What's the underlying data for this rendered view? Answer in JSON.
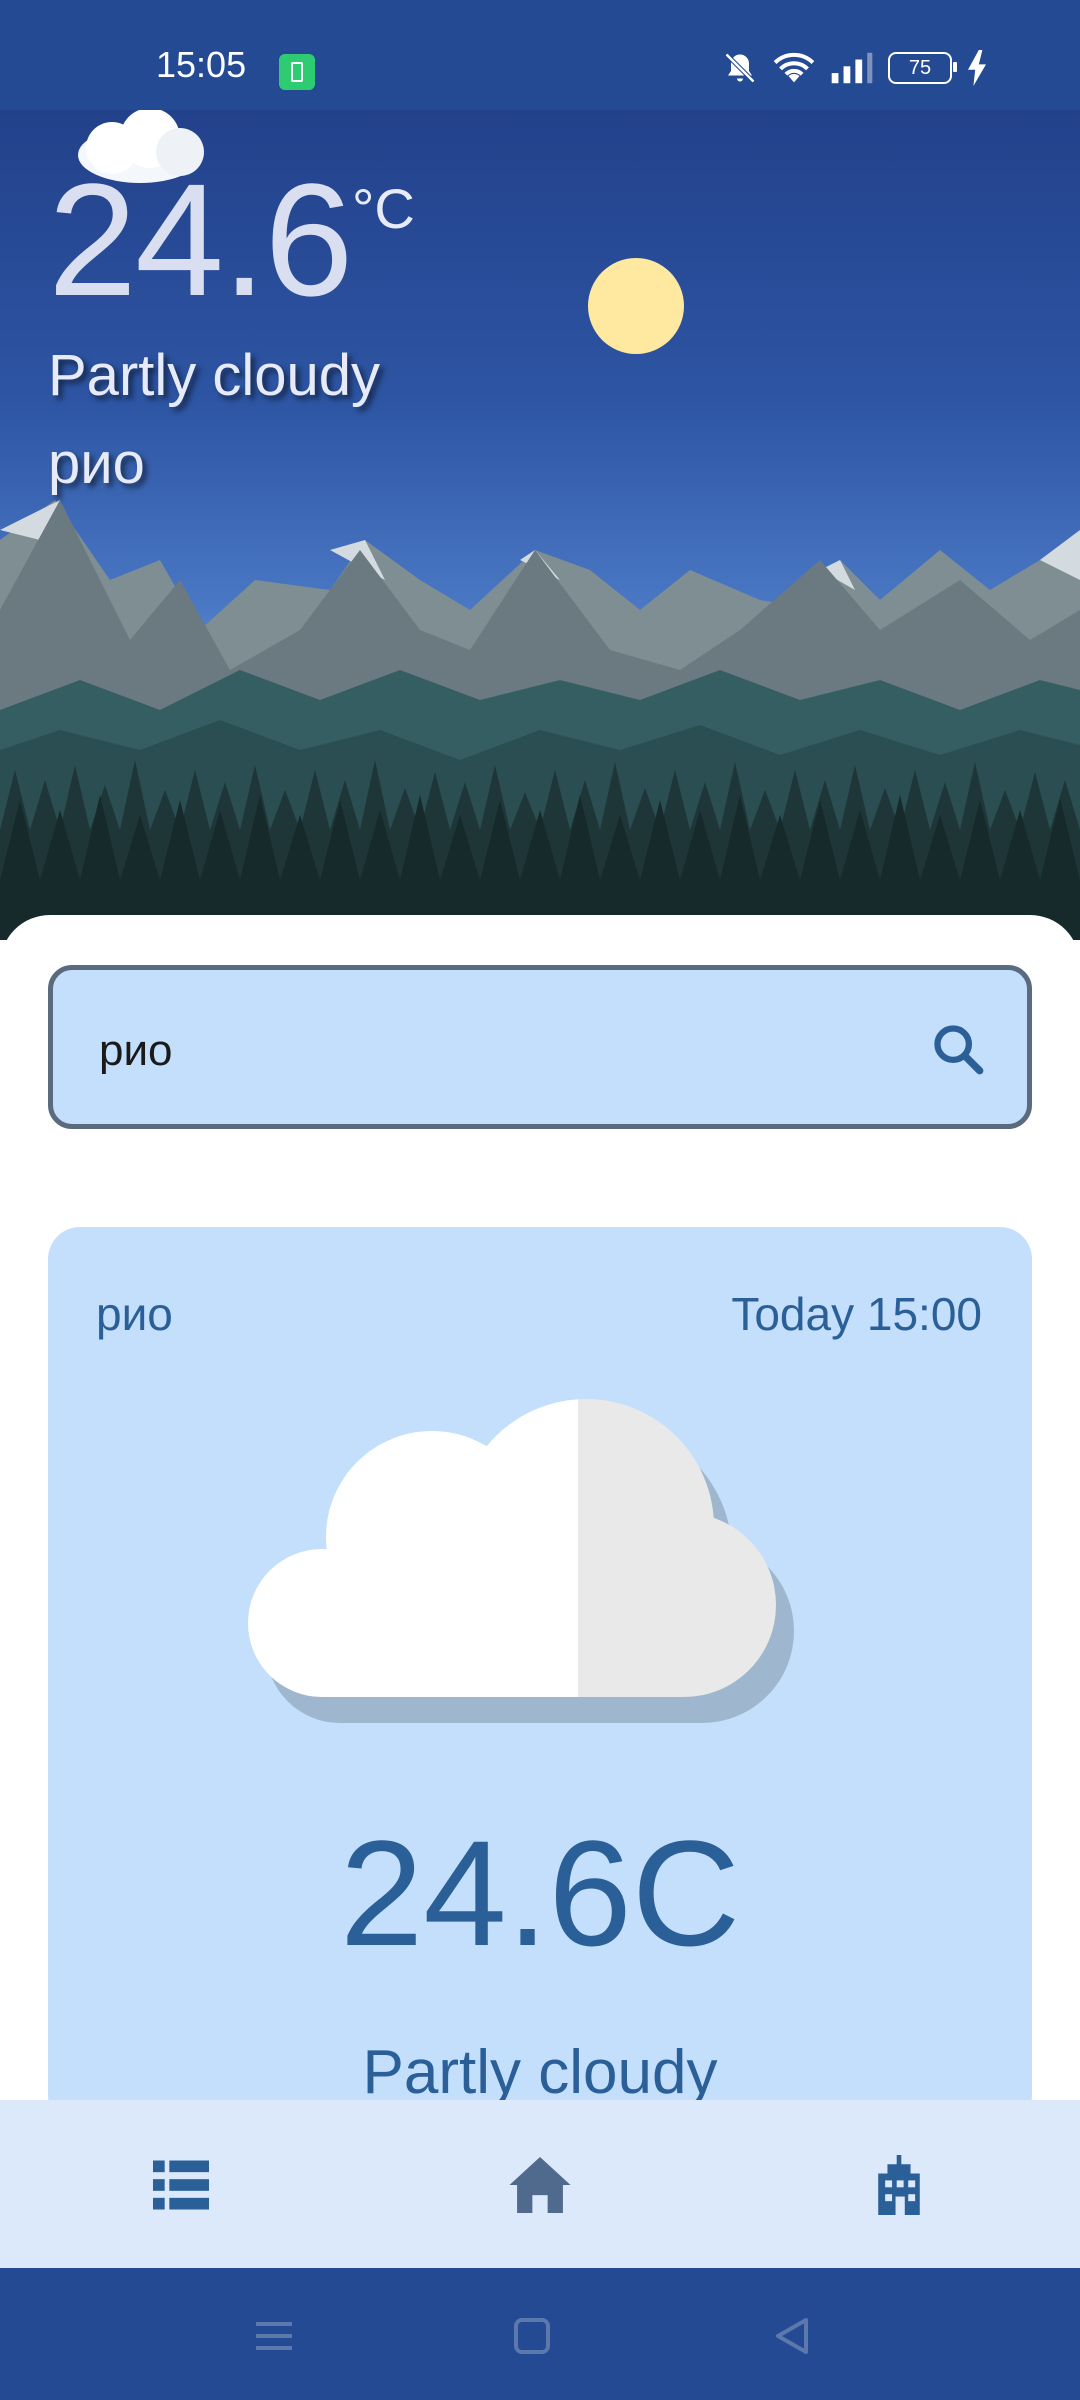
{
  "status_bar": {
    "time": "15:05",
    "battery_level": "75",
    "icons": [
      "battery-saver-icon",
      "mute-icon",
      "wifi-icon",
      "signal-icon",
      "battery-icon",
      "charging-icon"
    ]
  },
  "hero": {
    "temperature": "24.6",
    "unit": "°C",
    "condition": "Partly cloudy",
    "city": "рио"
  },
  "search": {
    "value": "рио",
    "placeholder": ""
  },
  "card": {
    "city": "рио",
    "time": "Today 15:00",
    "temperature": "24.6C",
    "condition": "Partly cloudy",
    "icon": "partly-cloudy-icon"
  },
  "bottom_nav": {
    "items": [
      "list-icon",
      "home-icon",
      "city-icon"
    ]
  },
  "system_nav": {
    "items": [
      "menu-icon",
      "home-square-icon",
      "back-icon"
    ]
  },
  "colors": {
    "accent": "#2a5f98",
    "card_bg": "#c4dffb",
    "status_bar_bg": "#244a93"
  }
}
